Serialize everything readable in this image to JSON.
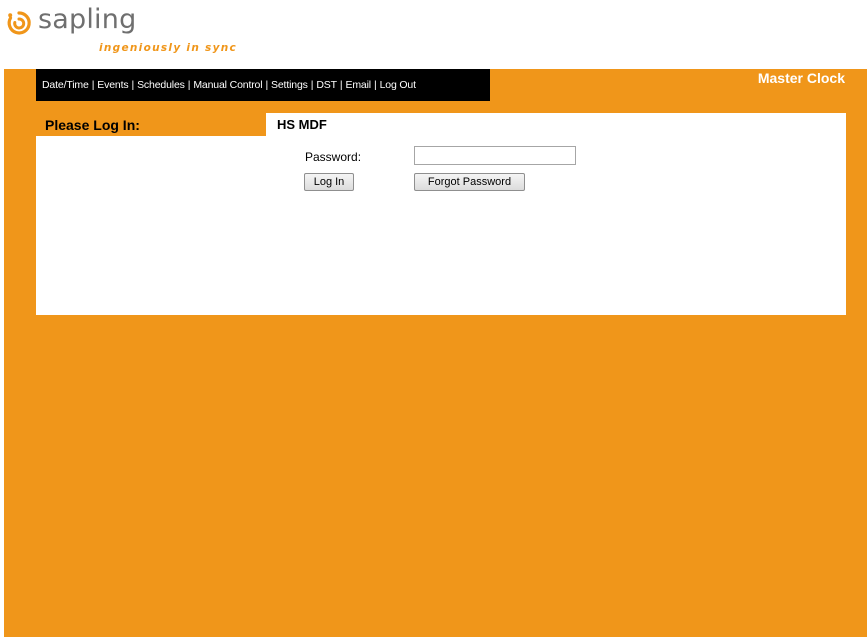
{
  "logo": {
    "wordmark": "sapling",
    "tagline": "ingeniously in sync",
    "icon": "sapling-swirl-logo",
    "brand_color": "#f0961a"
  },
  "nav": {
    "items": [
      {
        "label": "Date/Time"
      },
      {
        "label": "Events"
      },
      {
        "label": "Schedules"
      },
      {
        "label": "Manual Control"
      },
      {
        "label": "Settings"
      },
      {
        "label": "DST"
      },
      {
        "label": "Email"
      },
      {
        "label": "Log Out"
      }
    ],
    "separator": "|"
  },
  "header": {
    "title": "Master Clock"
  },
  "login": {
    "section_label": "Please Log In:",
    "device_name": "HS MDF",
    "password_label": "Password:",
    "password_value": "",
    "login_button": "Log In",
    "forgot_button": "Forgot Password"
  },
  "colors": {
    "background": "#f0961a",
    "nav_background": "#000000",
    "panel": "#ffffff"
  }
}
